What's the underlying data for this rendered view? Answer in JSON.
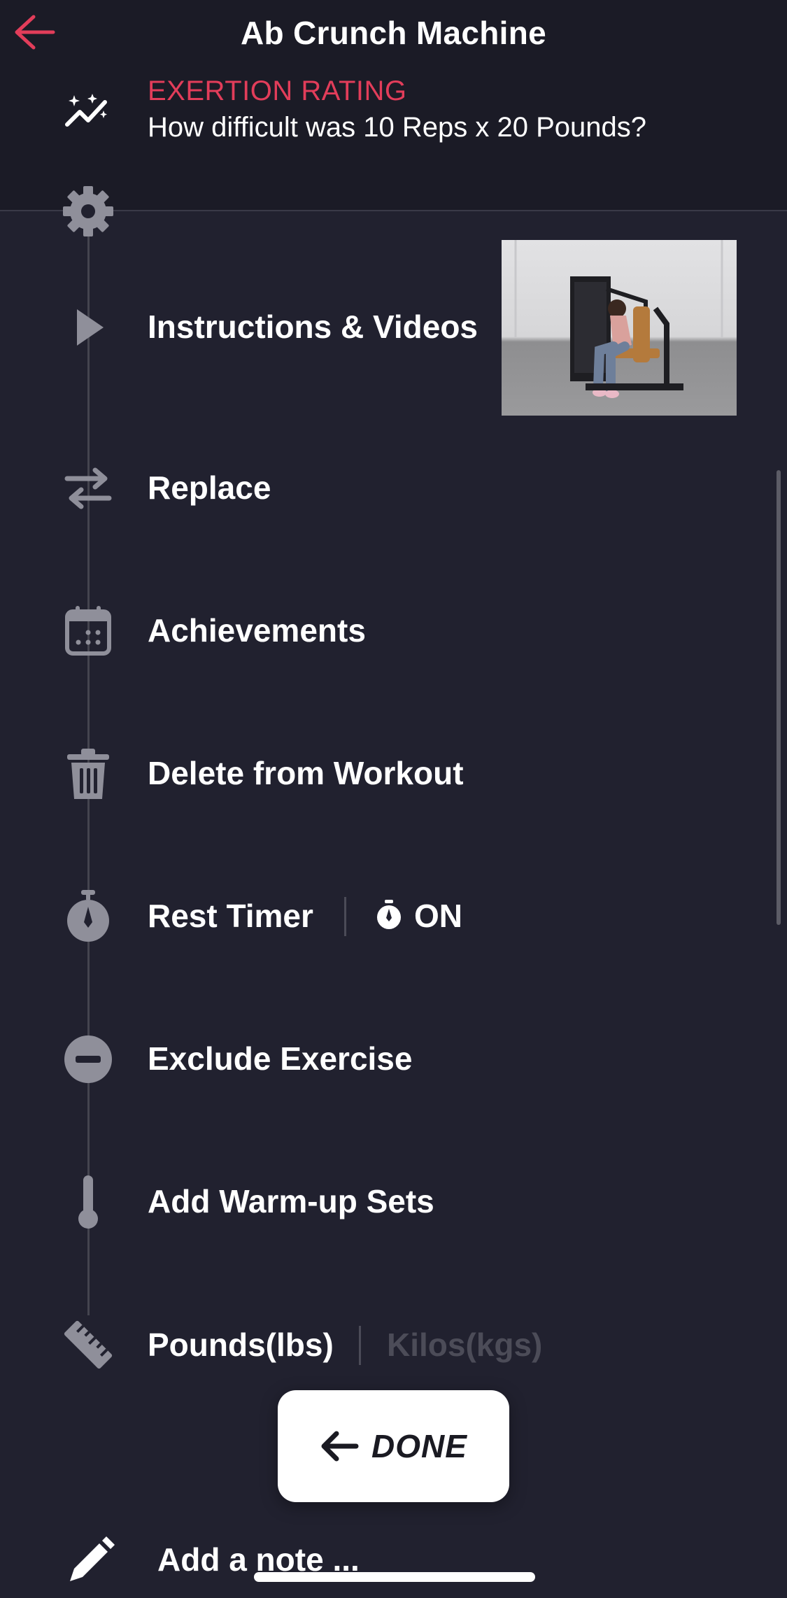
{
  "header": {
    "title": "Ab Crunch Machine",
    "exertion_label": "EXERTION RATING",
    "exertion_question": "How difficult was 10 Reps x 20 Pounds?"
  },
  "menu": {
    "instructions": "Instructions & Videos",
    "replace": "Replace",
    "achievements": "Achievements",
    "delete": "Delete from Workout",
    "rest_timer": "Rest Timer",
    "rest_timer_state": "ON",
    "exclude": "Exclude Exercise",
    "warmup": "Add Warm-up Sets",
    "unit_pounds": "Pounds(lbs)",
    "unit_kilos": "Kilos(kgs)"
  },
  "done_label": "DONE",
  "note_label": "Add a note ...",
  "colors": {
    "background": "#21212f",
    "header_background": "#1b1b26",
    "accent": "#e23d5a",
    "icon_gray": "#8f8f9a"
  },
  "icons": {
    "back": "arrow-left-icon",
    "exertion": "sparkle-chart-icon",
    "settings": "gear-icon",
    "instructions": "play-icon",
    "replace": "swap-arrows-icon",
    "achievements": "calendar-icon",
    "delete": "trash-icon",
    "rest_timer": "stopwatch-icon",
    "exclude": "minus-circle-icon",
    "warmup": "thermometer-icon",
    "units": "ruler-icon",
    "done": "arrow-left-icon",
    "note": "pencil-icon"
  }
}
